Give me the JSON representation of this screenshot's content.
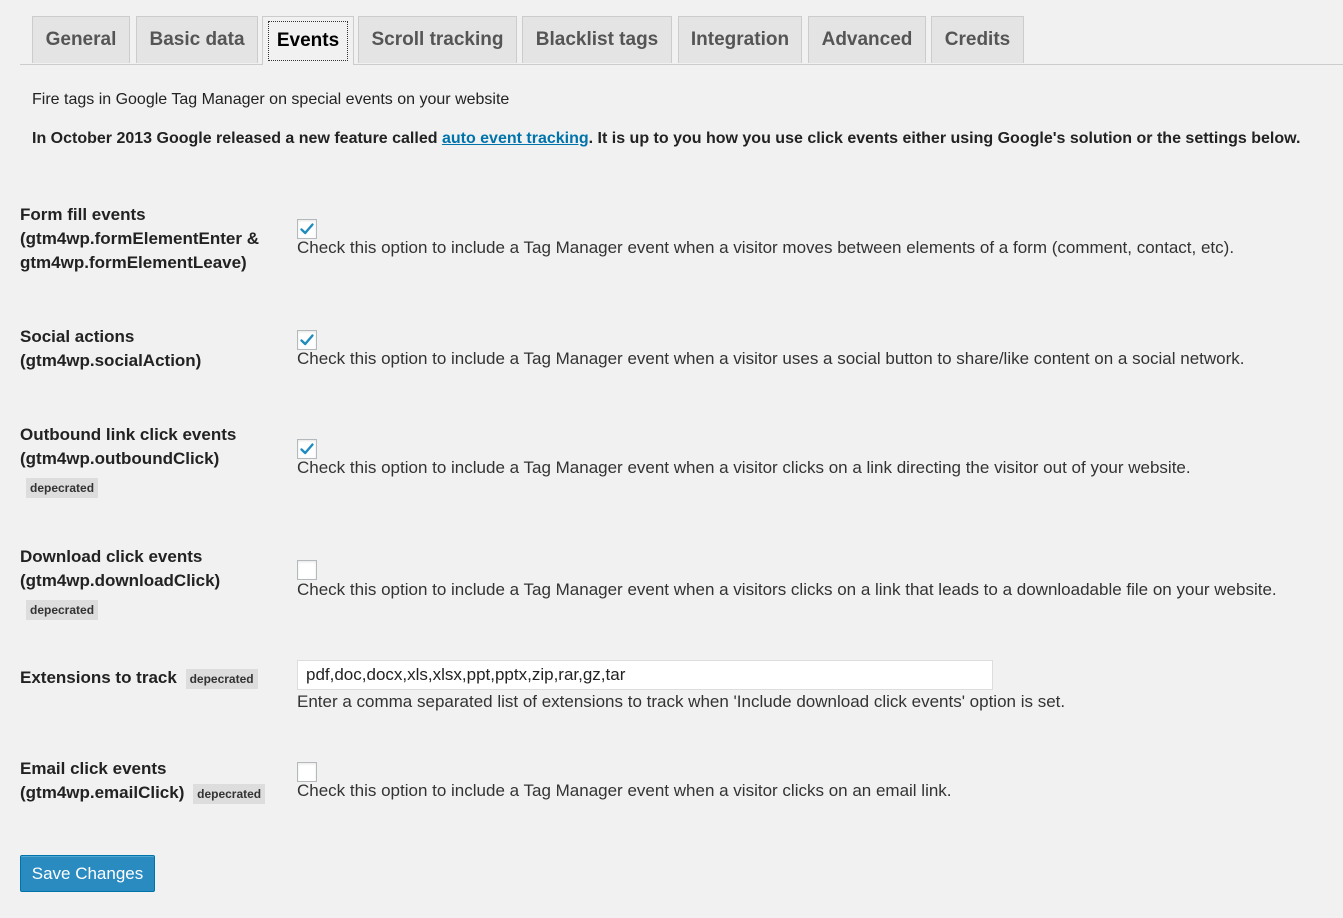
{
  "tabs": [
    "General",
    "Basic data",
    "Events",
    "Scroll tracking",
    "Blacklist tags",
    "Integration",
    "Advanced",
    "Credits"
  ],
  "active_tab": "Events",
  "intro_text": "Fire tags in Google Tag Manager on special events on your website",
  "notice": {
    "before": "In October 2013 Google released a new feature called ",
    "link": "auto event tracking",
    "after": ". It is up to you how you use click events either using Google's solution or the settings below."
  },
  "deprecated_badge": "depecrated",
  "fields": {
    "form_fill": {
      "label_1": "Form fill events",
      "label_2": "(gtm4wp.formElementEnter &",
      "label_3": "gtm4wp.formElementLeave)",
      "checked": true,
      "description": "Check this option to include a Tag Manager event when a visitor moves between elements of a form (comment, contact, etc)."
    },
    "social": {
      "label_1": "Social actions",
      "label_2": "(gtm4wp.socialAction)",
      "checked": true,
      "description": "Check this option to include a Tag Manager event when a visitor uses a social button to share/like content on a social network."
    },
    "outbound": {
      "label_1": "Outbound link click events",
      "label_2": "(gtm4wp.outboundClick)",
      "checked": true,
      "description": "Check this option to include a Tag Manager event when a visitor clicks on a link directing the visitor out of your website."
    },
    "download": {
      "label_1": "Download click events",
      "label_2": "(gtm4wp.downloadClick)",
      "checked": false,
      "description": "Check this option to include a Tag Manager event when a visitors clicks on a link that leads to a downloadable file on your website."
    },
    "extensions": {
      "label": "Extensions to track",
      "value": "pdf,doc,docx,xls,xlsx,ppt,pptx,zip,rar,gz,tar",
      "description": "Enter a comma separated list of extensions to track when 'Include download click events' option is set."
    },
    "email": {
      "label_1": "Email click events",
      "label_2": "(gtm4wp.emailClick)",
      "checked": false,
      "description": "Check this option to include a Tag Manager event when a visitor clicks on an email link."
    }
  },
  "save_label": "Save Changes",
  "colors": {
    "accent": "#0073aa",
    "button": "#2a8bc1",
    "check": "#1e8cbe"
  }
}
